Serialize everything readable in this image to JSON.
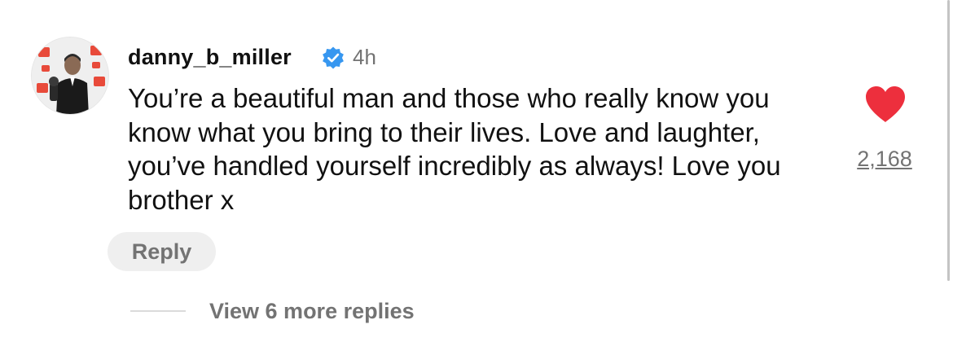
{
  "comment": {
    "username": "danny_b_miller",
    "verified": true,
    "timestamp": "4h",
    "text": "You’re a beautiful man and those who really know you know what you bring to their lives. Love and laughter, you’ve handled yourself incredibly as always! Love you brother x",
    "likes": "2,168",
    "liked": true,
    "reply_label": "Reply",
    "view_replies_label": "View 6 more replies"
  },
  "icons": {
    "verified": "verified-badge-icon",
    "like": "heart-icon"
  },
  "colors": {
    "verified_blue": "#3797f0",
    "heart_red": "#ed2f3d",
    "secondary_text": "#737373",
    "reply_bg": "#efefef"
  }
}
